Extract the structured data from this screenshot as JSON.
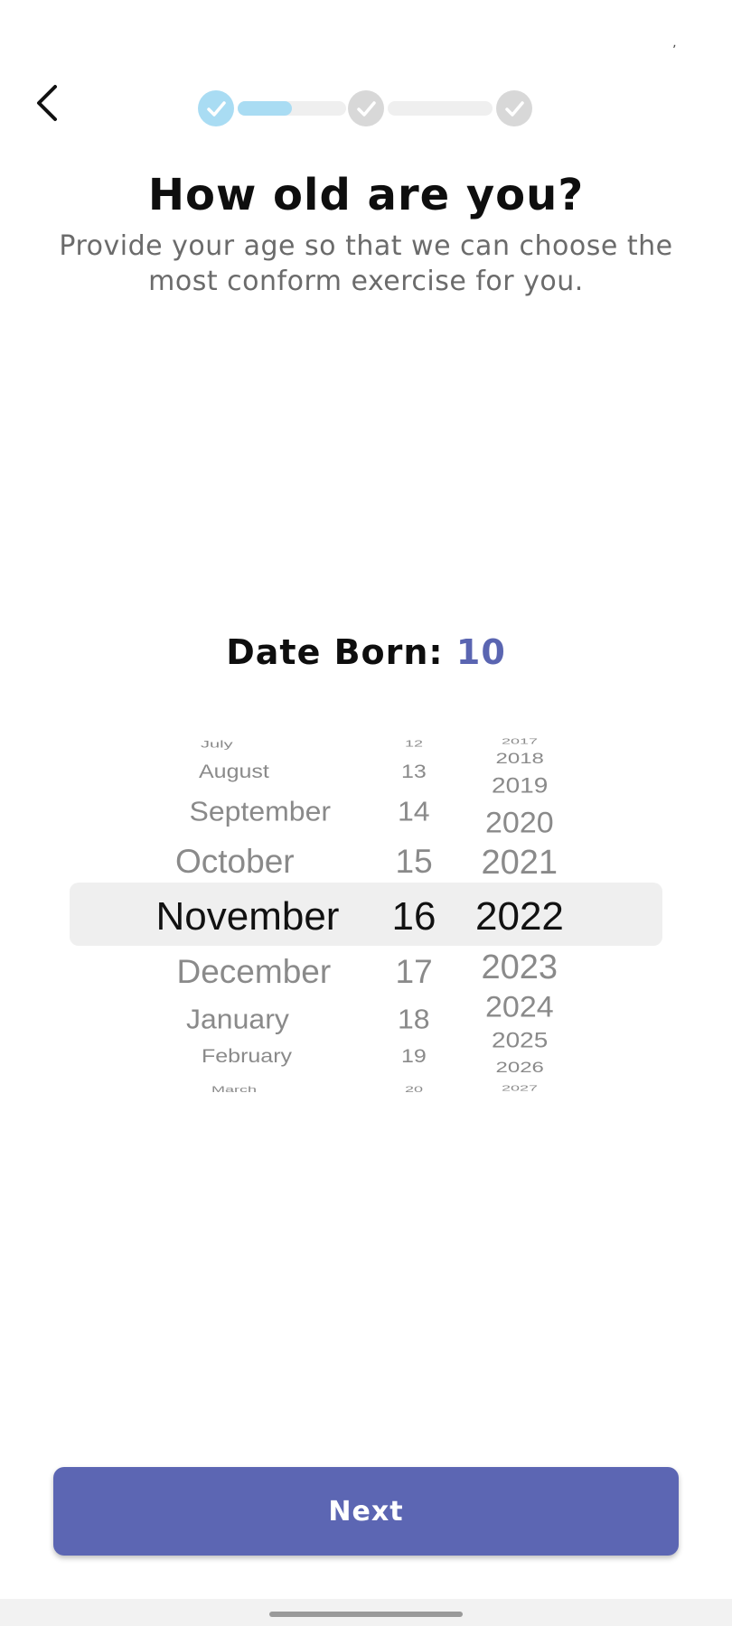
{
  "header": {
    "back_icon": "chevron-left-icon",
    "status_mark": "ʼ"
  },
  "progress": {
    "steps": [
      {
        "state": "completed",
        "icon": "check-icon"
      },
      {
        "state": "pending",
        "icon": "check-icon"
      },
      {
        "state": "pending",
        "icon": "check-icon"
      }
    ],
    "segments": [
      {
        "fill": 0.5
      },
      {
        "fill": 0
      }
    ],
    "active_color": "#a9dcf3",
    "inactive_color": "#d8d8d8"
  },
  "main": {
    "title": "How old are you?",
    "subtitle_line1": "Provide your age so that we can choose the",
    "subtitle_line2": "most conform exercise for you."
  },
  "date_born": {
    "label": "Date Born: ",
    "value": "10",
    "value_color": "#5a65b1"
  },
  "picker": {
    "months": [
      "July",
      "August",
      "September",
      "October",
      "November",
      "December",
      "January",
      "February",
      "March"
    ],
    "days": [
      "12",
      "13",
      "14",
      "15",
      "16",
      "17",
      "18",
      "19",
      "20"
    ],
    "years_top": [
      "2017",
      "2018",
      "2019",
      "2020",
      "2021"
    ],
    "years": [
      "2017",
      "2018",
      "2019",
      "2020",
      "2021",
      "2022",
      "2023",
      "2024",
      "2025",
      "2026",
      "2027"
    ],
    "selected_month": "November",
    "selected_day": "16",
    "selected_year": "2022"
  },
  "footer": {
    "next_label": "Next",
    "button_color": "#5c66b3"
  }
}
